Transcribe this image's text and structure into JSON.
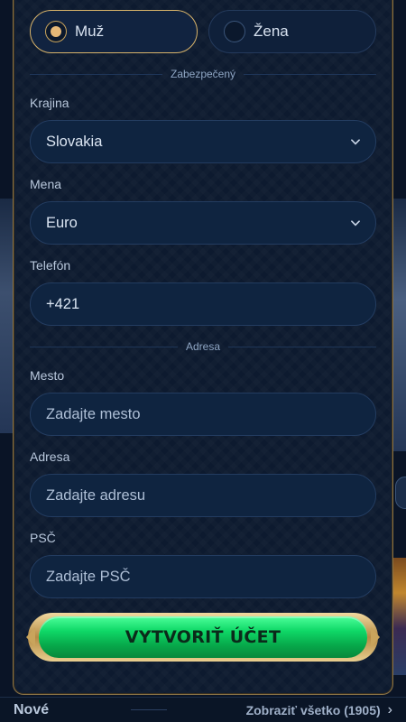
{
  "gender": {
    "options": [
      {
        "label": "Muž",
        "selected": true
      },
      {
        "label": "Žena",
        "selected": false
      }
    ]
  },
  "sections": {
    "secure": "Zabezpečený",
    "address": "Adresa"
  },
  "fields": {
    "country": {
      "label": "Krajina",
      "value": "Slovakia"
    },
    "currency": {
      "label": "Mena",
      "value": "Euro"
    },
    "phone": {
      "label": "Telefón",
      "value": "+421"
    },
    "city": {
      "label": "Mesto",
      "placeholder": "Zadajte mesto"
    },
    "address": {
      "label": "Adresa",
      "placeholder": "Zadajte adresu"
    },
    "zip": {
      "label": "PSČ",
      "placeholder": "Zadajte PSČ"
    }
  },
  "submit": {
    "label": "VYTVORIŤ ÚČET"
  },
  "bottom": {
    "title": "Nové",
    "link": "Zobraziť všetko (1905)"
  },
  "colors": {
    "accent_gold": "#d9b46a",
    "button_green": "#0fd867",
    "background": "#0a1426"
  },
  "icons": {
    "dropdown": "chevron-down-icon",
    "more": "chevron-right-icon"
  }
}
